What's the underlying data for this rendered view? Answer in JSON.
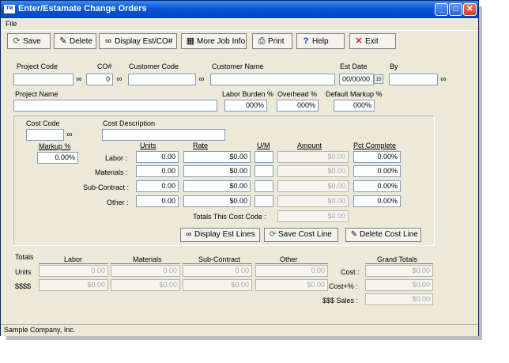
{
  "window": {
    "app_icon": "TM",
    "title": "Enter/Estamate Change Orders"
  },
  "menu": {
    "file": "File"
  },
  "toolbar": {
    "save": "Save",
    "delete": "Delete",
    "display_est": "Display Est/CO#",
    "more_job_info": "More Job Info",
    "print": "Print",
    "help": "Help",
    "exit": "Exit"
  },
  "header": {
    "project_code_label": "Project Code",
    "project_code": "",
    "co_label": "CO#",
    "co_value": "0",
    "customer_code_label": "Customer Code",
    "customer_code": "",
    "customer_name_label": "Customer Name",
    "customer_name": "",
    "est_date_label": "Est Date",
    "est_date": "00/00/00",
    "by_label": "By",
    "by_value": "",
    "project_name_label": "Project Name",
    "project_name": "",
    "labor_burden_label": "Labor Burden %",
    "labor_burden": "000%",
    "overhead_label": "Overhead %",
    "overhead": "000%",
    "default_markup_label": "Default Markup %",
    "default_markup": "000%"
  },
  "cost": {
    "cost_code_label": "Cost Code",
    "cost_code": "",
    "cost_desc_label": "Cost Description",
    "cost_desc": "",
    "markup_label": "Markup %",
    "markup": "0.00%",
    "col_units": "Units",
    "col_rate": "Rate",
    "col_um": "U/M",
    "col_amount": "Amount",
    "col_pct": "Pct Complete",
    "rows": [
      {
        "label": "Labor :",
        "units": "0.00",
        "rate": "$0.00",
        "um": "",
        "amount": "$0.00",
        "pct": "0.00%"
      },
      {
        "label": "Materials :",
        "units": "0.00",
        "rate": "$0.00",
        "um": "",
        "amount": "$0.00",
        "pct": "0.00%"
      },
      {
        "label": "Sub-Contract :",
        "units": "0.00",
        "rate": "$0.00",
        "um": "",
        "amount": "$0.00",
        "pct": "0.00%"
      },
      {
        "label": "Other :",
        "units": "0.00",
        "rate": "$0.00",
        "um": "",
        "amount": "$0.00",
        "pct": "0.00%"
      }
    ],
    "totals_label": "Totals This Cost Code :",
    "totals_value": "$0.00",
    "display_est_lines": "Display Est Lines",
    "save_cost_line": "Save Cost Line",
    "delete_cost_line": "Delete Cost Line"
  },
  "totals": {
    "label": "Totals",
    "col_labor": "Labor",
    "col_materials": "Materials",
    "col_sub": "Sub-Contract",
    "col_other": "Other",
    "row_units": "Units",
    "row_dollars": "$$$$",
    "units": [
      "0.00",
      "0.00",
      "0.00",
      "0.00"
    ],
    "dollars": [
      "$0.00",
      "$0.00",
      "$0.00",
      "$0.00"
    ],
    "grand_label": "Grand Totals",
    "cost_label": "Cost :",
    "cost": "$0.00",
    "cost_pct_label": "Cost+% :",
    "cost_pct": "$0.00",
    "sales_label": "$$$ Sales :",
    "sales": "$0.00"
  },
  "status": {
    "company": "Sample Company, Inc."
  }
}
